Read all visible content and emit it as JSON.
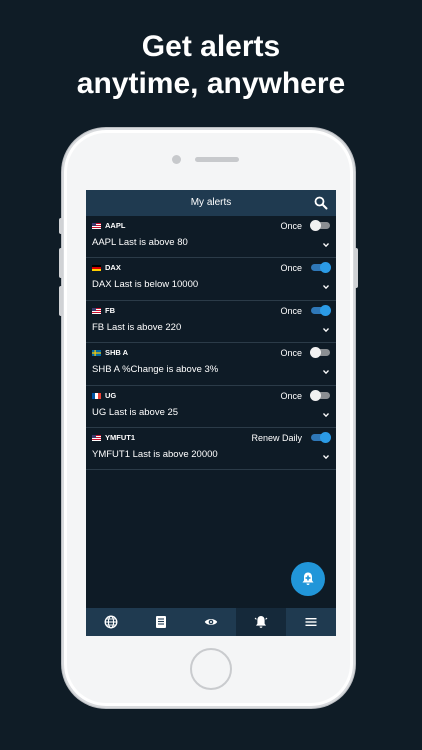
{
  "headline": {
    "line1": "Get alerts",
    "line2": "anytime, anywhere"
  },
  "app": {
    "title": "My alerts",
    "accent_color": "#2196d9",
    "header_color": "#1f3a50"
  },
  "alerts": [
    {
      "symbol": "AAPL",
      "flag": "us-flag-icon",
      "frequency": "Once",
      "enabled": false,
      "description": "AAPL Last is above 80"
    },
    {
      "symbol": "DAX",
      "flag": "de-flag-icon",
      "frequency": "Once",
      "enabled": true,
      "description": "DAX Last is below 10000"
    },
    {
      "symbol": "FB",
      "flag": "us-flag-icon",
      "frequency": "Once",
      "enabled": true,
      "description": "FB Last is above 220"
    },
    {
      "symbol": "SHB A",
      "flag": "se-flag-icon",
      "frequency": "Once",
      "enabled": false,
      "description": "SHB A %Change is above 3%"
    },
    {
      "symbol": "UG",
      "flag": "fr-flag-icon",
      "frequency": "Once",
      "enabled": false,
      "description": "UG Last is above 25"
    },
    {
      "symbol": "YMFUT1",
      "flag": "us-flag-icon",
      "frequency": "Renew Daily",
      "enabled": true,
      "description": "YMFUT1 Last is above 20000"
    }
  ],
  "bottom_nav": [
    {
      "icon": "globe-icon",
      "active": false
    },
    {
      "icon": "document-icon",
      "active": false
    },
    {
      "icon": "eye-icon",
      "active": false
    },
    {
      "icon": "bell-icon",
      "active": true
    },
    {
      "icon": "menu-icon",
      "active": false
    }
  ]
}
